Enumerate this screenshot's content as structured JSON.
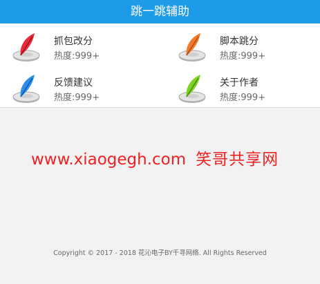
{
  "header": {
    "title": "跳一跳辅助"
  },
  "menu": [
    {
      "name": "抓包改分",
      "hot": "热度:999+",
      "icon": "red-feather-icon",
      "color": "#e8293b"
    },
    {
      "name": "脚本跳分",
      "hot": "热度:999+",
      "icon": "orange-feather-icon",
      "color": "#f07a2a"
    },
    {
      "name": "反馈建议",
      "hot": "热度:999+",
      "icon": "blue-feather-icon",
      "color": "#2d8ee8"
    },
    {
      "name": "关于作者",
      "hot": "热度:999+",
      "icon": "green-feather-icon",
      "color": "#7ed321"
    }
  ],
  "watermark": {
    "url": "www.xiaogegh.com",
    "text": "笑哥共享网"
  },
  "footer": {
    "copyright": "Copyright © 2017 - 2018 花沁电子BY千寻网络. All Rights Reserved"
  }
}
